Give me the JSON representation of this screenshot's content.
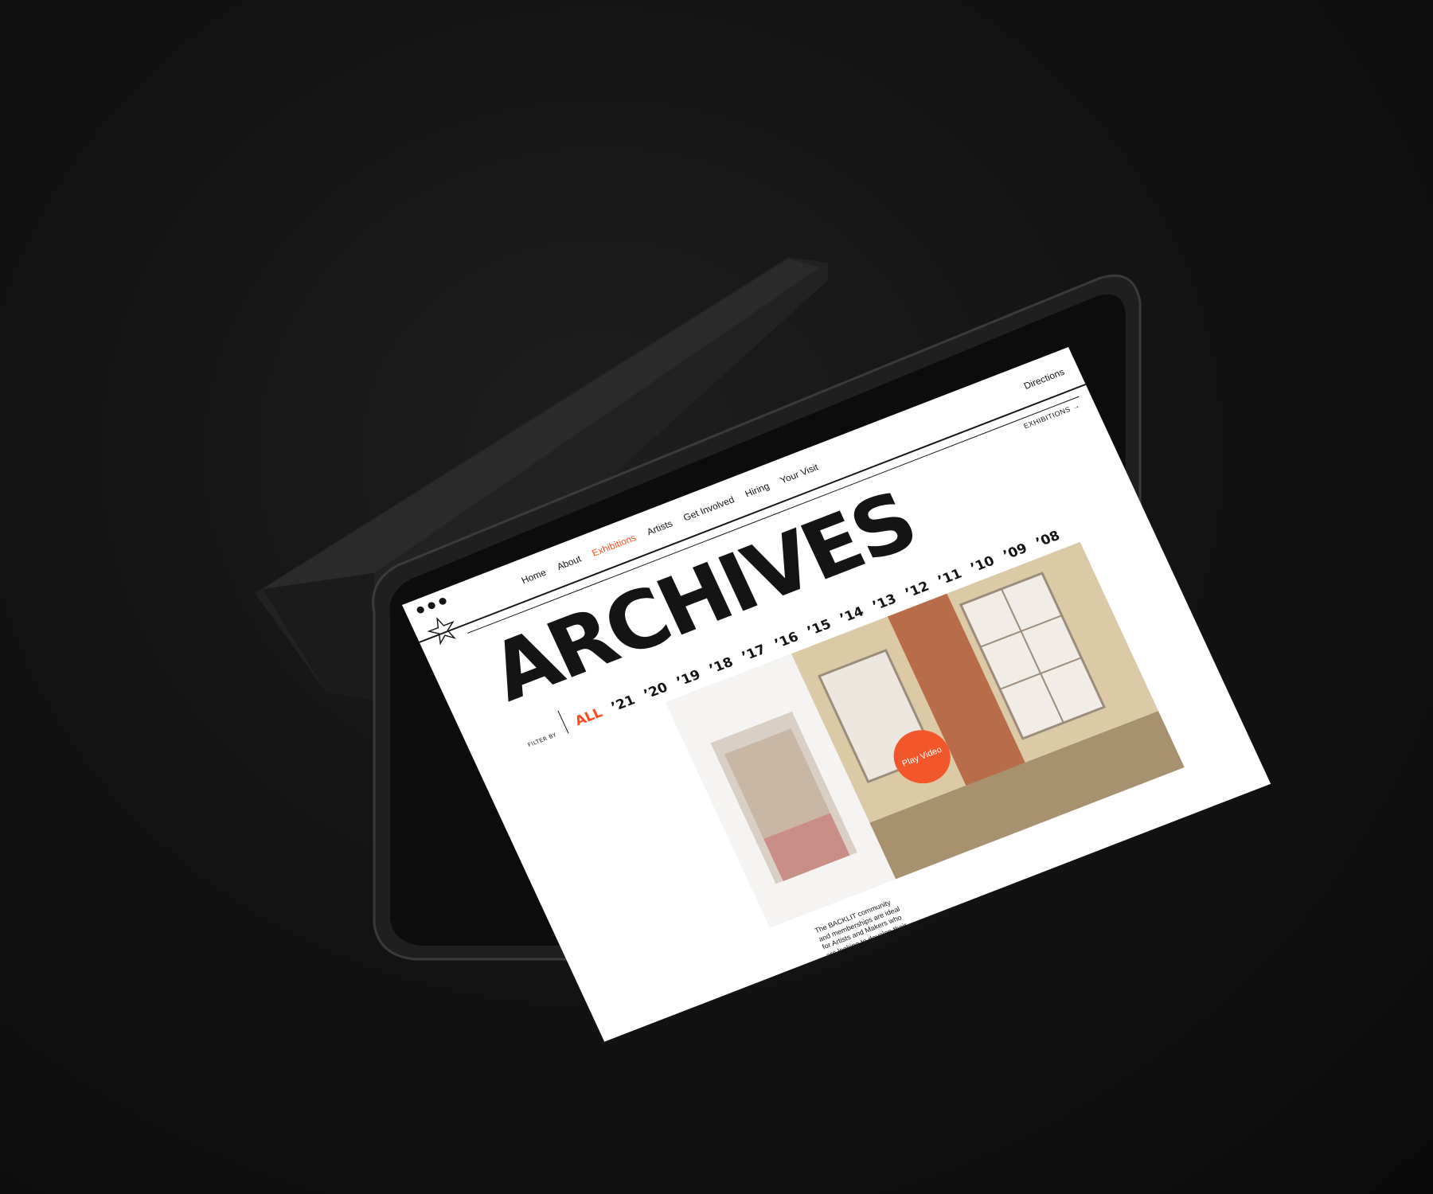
{
  "site": {
    "nav": [
      "Home",
      "About",
      "Exhibitions",
      "Artists",
      "Get Involved",
      "Hiring",
      "Your Visit"
    ],
    "active_nav": "Exhibitions",
    "directions": "Directions",
    "exhibitions_link": "EXHIBITIONS →"
  },
  "page": {
    "title": "ARCHIVES",
    "filter_label": "FILTER BY",
    "years": [
      "ALL",
      "’21",
      "’20",
      "’19",
      "’18",
      "’17",
      "’16",
      "’15",
      "’14",
      "’13",
      "’12",
      "’11",
      "’10",
      "’09",
      "’08"
    ],
    "active_year": "ALL",
    "play_video": "Play Video",
    "intro_text": "The BACKLIT community and memberships are ideal for Artists and Makers who are looking to develop their"
  },
  "colors": {
    "accent": "#ff4b1f",
    "ink": "#141414",
    "background": "#0e0e0e"
  },
  "icons": {
    "logo": "star-logo-icon",
    "window_dots": "window-dots-icon",
    "arrow": "arrow-right-icon"
  }
}
